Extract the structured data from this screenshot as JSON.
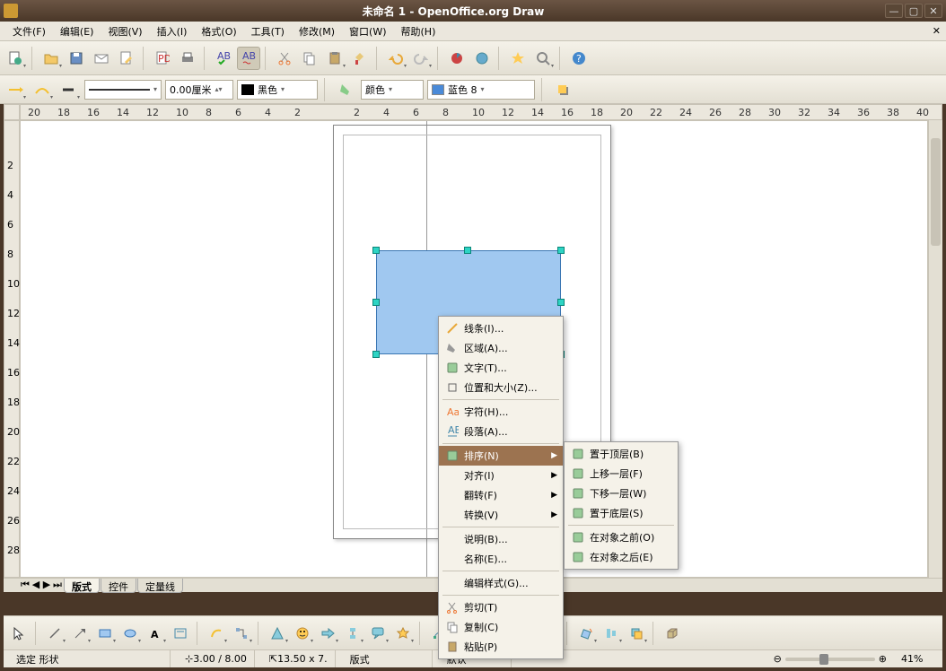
{
  "title": "未命名 1 - OpenOffice.org Draw",
  "menu": [
    "文件(F)",
    "编辑(E)",
    "视图(V)",
    "插入(I)",
    "格式(O)",
    "工具(T)",
    "修改(M)",
    "窗口(W)",
    "帮助(H)"
  ],
  "props": {
    "line_width": "0.00厘米",
    "line_color": "黑色",
    "color_label": "颜色",
    "fill_color": "蓝色 8"
  },
  "ruler_h": [
    "20",
    "18",
    "16",
    "14",
    "12",
    "10",
    "8",
    "6",
    "4",
    "2",
    "",
    "2",
    "4",
    "6",
    "8",
    "10",
    "12",
    "14",
    "16",
    "18",
    "20",
    "22",
    "24",
    "26",
    "28",
    "30",
    "32",
    "34",
    "36",
    "38",
    "40"
  ],
  "ruler_v": [
    "",
    "2",
    "4",
    "6",
    "8",
    "10",
    "12",
    "14",
    "16",
    "18",
    "20",
    "22",
    "24",
    "26",
    "28"
  ],
  "tabs": [
    "版式",
    "控件",
    "定量线"
  ],
  "ctx1": [
    {
      "label": "线条(I)...",
      "icon": "line"
    },
    {
      "label": "区域(A)...",
      "icon": "area"
    },
    {
      "label": "文字(T)...",
      "icon": "text"
    },
    {
      "label": "位置和大小(Z)...",
      "icon": "possize"
    },
    {
      "sep": true
    },
    {
      "label": "字符(H)...",
      "icon": "char"
    },
    {
      "label": "段落(A)...",
      "icon": "para"
    },
    {
      "sep": true
    },
    {
      "label": "排序(N)",
      "icon": "arrange",
      "sub": true,
      "hl": true
    },
    {
      "label": "对齐(I)",
      "sub": true
    },
    {
      "label": "翻转(F)",
      "sub": true
    },
    {
      "label": "转换(V)",
      "sub": true
    },
    {
      "sep": true
    },
    {
      "label": "说明(B)...",
      "icon": null
    },
    {
      "label": "名称(E)...",
      "icon": null
    },
    {
      "sep": true
    },
    {
      "label": "编辑样式(G)...",
      "icon": null
    },
    {
      "sep": true
    },
    {
      "label": "剪切(T)",
      "icon": "cut"
    },
    {
      "label": "复制(C)",
      "icon": "copy"
    },
    {
      "label": "粘贴(P)",
      "icon": "paste"
    }
  ],
  "ctx2": [
    {
      "label": "置于顶层(B)",
      "icon": "front"
    },
    {
      "label": "上移一层(F)",
      "icon": "forward"
    },
    {
      "label": "下移一层(W)",
      "icon": "backward"
    },
    {
      "label": "置于底层(S)",
      "icon": "back"
    },
    {
      "sep": true
    },
    {
      "label": "在对象之前(O)",
      "icon": "before"
    },
    {
      "label": "在对象之后(E)",
      "icon": "behind"
    }
  ],
  "status": {
    "selection": "选定 形状",
    "pos": "3.00 / 8.00",
    "size": "13.50 x 7.",
    "slide": "版式",
    "mode": "默认",
    "zoom": "41%"
  }
}
